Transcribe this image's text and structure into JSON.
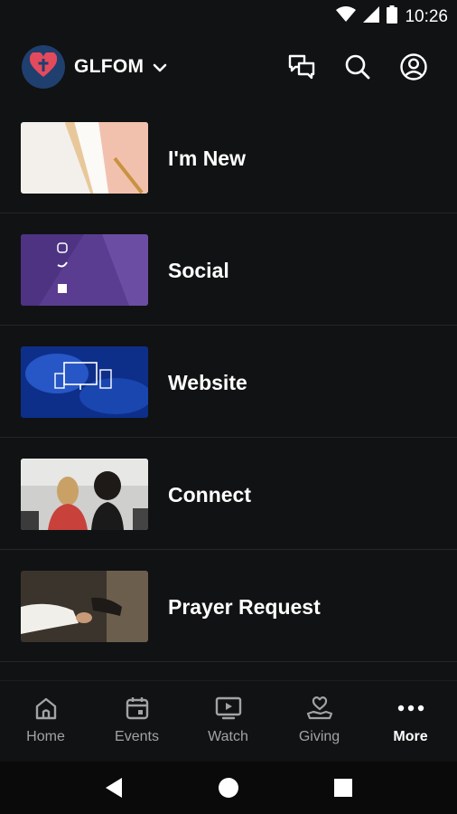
{
  "status_bar": {
    "time": "10:26"
  },
  "header": {
    "app_name": "GLFOM",
    "logo_icon": "heart-cross-icon",
    "actions": [
      "chat-icon",
      "search-icon",
      "account-icon"
    ]
  },
  "menu_items": [
    {
      "label": "I'm New",
      "thumbnail": "papers-and-pen-image"
    },
    {
      "label": "Social",
      "thumbnail": "social-accounts-image",
      "thumbnail_text": [
        "Instagram",
        "Twitter",
        "Facebook"
      ]
    },
    {
      "label": "Website",
      "thumbnail": "devices-image"
    },
    {
      "label": "Connect",
      "thumbnail": "people-image"
    },
    {
      "label": "Prayer Request",
      "thumbnail": "praying-hands-image"
    }
  ],
  "tabs": [
    {
      "label": "Home",
      "icon": "home-icon",
      "active": false
    },
    {
      "label": "Events",
      "icon": "calendar-icon",
      "active": false
    },
    {
      "label": "Watch",
      "icon": "play-screen-icon",
      "active": false
    },
    {
      "label": "Giving",
      "icon": "giving-hand-heart-icon",
      "active": false
    },
    {
      "label": "More",
      "icon": "more-dots-icon",
      "active": true
    }
  ],
  "colors": {
    "background": "#111213",
    "tab_inactive": "#a2a3a5",
    "tab_active": "#ffffff",
    "logo_bg": "#1f3f6e",
    "logo_heart": "#e34a5c"
  }
}
